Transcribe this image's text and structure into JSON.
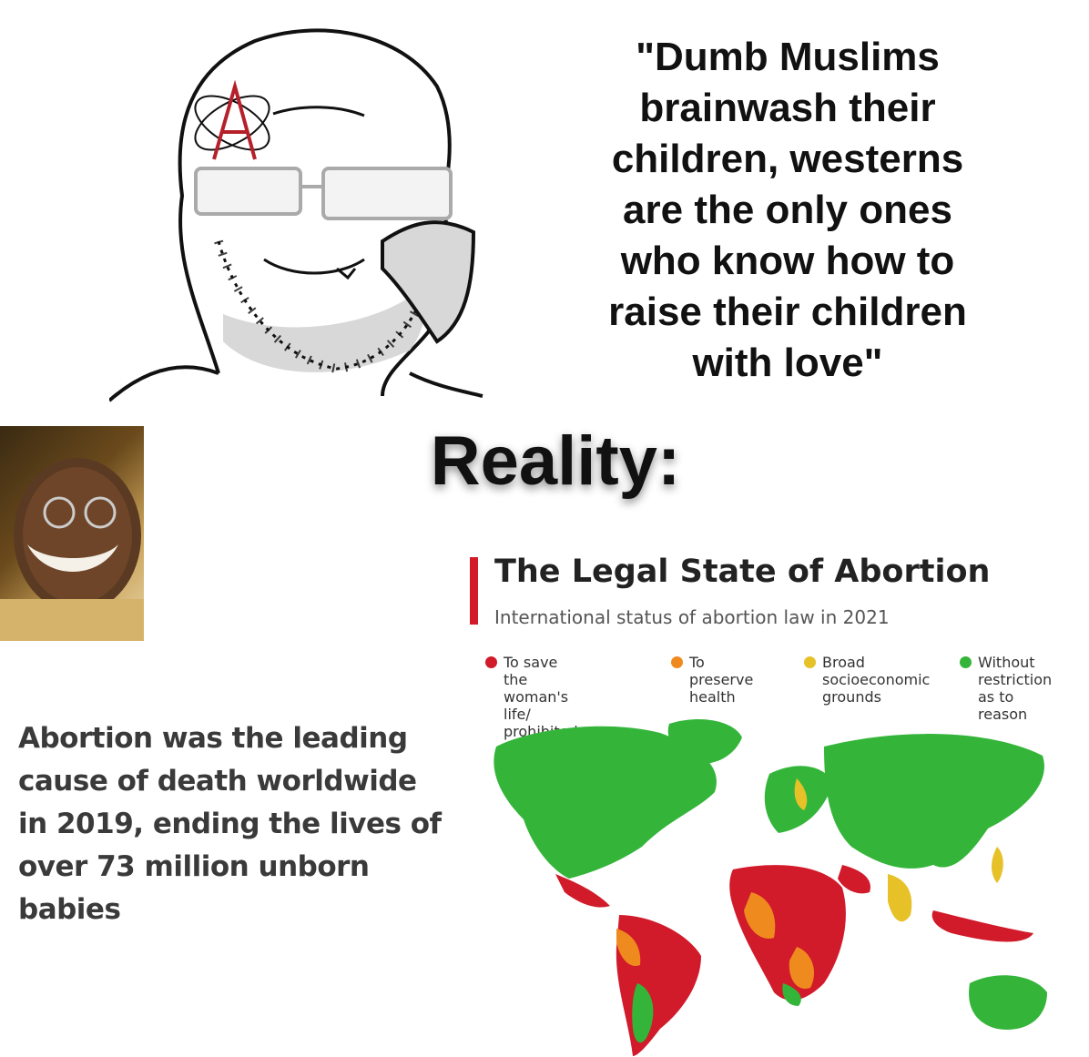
{
  "meme": {
    "quote": "\"Dumb Muslims\nbrainwash their\nchildren, westerns\nare the only ones\nwho know how to\nraise their children\nwith love\"",
    "reality_label": "Reality:",
    "stat_text": "Abortion was the leading\ncause of death worldwide\nin 2019, ending the lives of\nover 73 million unborn\nbabies"
  },
  "chart": {
    "title": "The Legal State of Abortion",
    "subtitle": "International status of abortion law in 2021",
    "accent_color": "#d11a2a",
    "legend": [
      {
        "label": "To save the\nwoman's life/\nprohibited entirely",
        "color": "#d11a2a"
      },
      {
        "label": "To preserve\nhealth",
        "color": "#ef8a1f"
      },
      {
        "label": "Broad\nsocioeconomic\ngrounds",
        "color": "#e6c128"
      },
      {
        "label": "Without\nrestriction\nas to reason",
        "color": "#34b53a"
      }
    ]
  },
  "colors": {
    "red": "#d11a2a",
    "orange": "#ef8a1f",
    "yellow": "#e6c128",
    "green": "#34b53a"
  }
}
